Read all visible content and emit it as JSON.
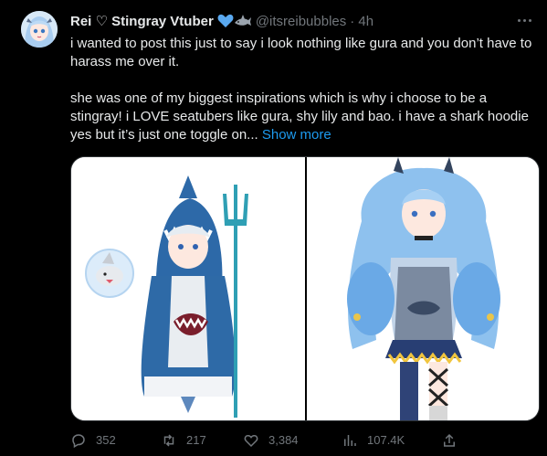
{
  "author": {
    "display_name": "Rei ♡ Stingray Vtuber",
    "handle": "@itsreibubbles",
    "time": "· 4h"
  },
  "tweet": {
    "text": "i wanted to post this just to say i look nothing like gura and you don’t have to harass me over it.\n\nshe was one of my biggest inspirations which is why i choose to be a stingray! i LOVE seatubers like gura, shy lily and bao. i have a shark hoodie yes but it’s just one toggle on...",
    "show_more": "Show more"
  },
  "media": [
    {
      "icon": "anime-shark-hoodie-character-illustration"
    },
    {
      "icon": "anime-stingray-character-illustration"
    }
  ],
  "actions": {
    "replies": "352",
    "retweets": "217",
    "likes": "3,384",
    "views": "107.4K"
  },
  "colors": {
    "background": "#000000",
    "text": "#e7e9ea",
    "secondary": "#71767b",
    "link": "#1d9bf0"
  }
}
